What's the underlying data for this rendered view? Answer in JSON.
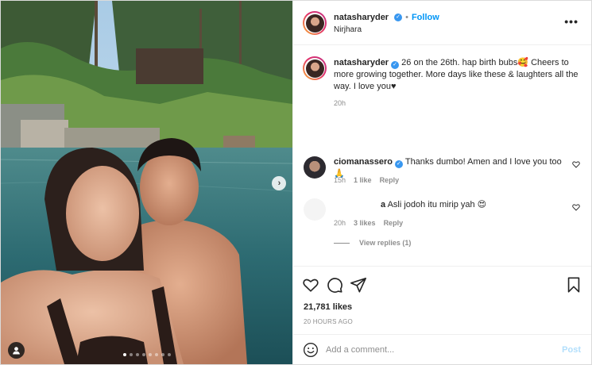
{
  "post": {
    "author": "natasharyder",
    "location": "Nirjhara",
    "follow_label": "Follow",
    "more_label": "•••"
  },
  "caption": {
    "username": "natasharyder",
    "text": "26 on the 26th. hap birth bubs🥰 Cheers to more growing together. More days like these & laughters all the way. I love you♥",
    "time": "20h"
  },
  "comments": [
    {
      "username": "ciomanassero",
      "text": "Thanks dumbo! Amen and I love you too 🙏",
      "time": "15h",
      "likes": "1 like",
      "reply": "Reply"
    },
    {
      "username": "a",
      "text": "Asli jodoh itu mirip yah 😍",
      "time": "20h",
      "likes": "3 likes",
      "reply": "Reply",
      "view_replies": "View replies (1)"
    }
  ],
  "stats": {
    "likes": "21,781 likes",
    "time_ago": "20 HOURS AGO"
  },
  "composer": {
    "placeholder": "Add a comment...",
    "post_label": "Post"
  },
  "carousel": {
    "count": 8,
    "active": 0
  },
  "colors": {
    "accent": "#0095f6",
    "verified": "#3897f0",
    "post_disabled": "#b2dffc"
  }
}
